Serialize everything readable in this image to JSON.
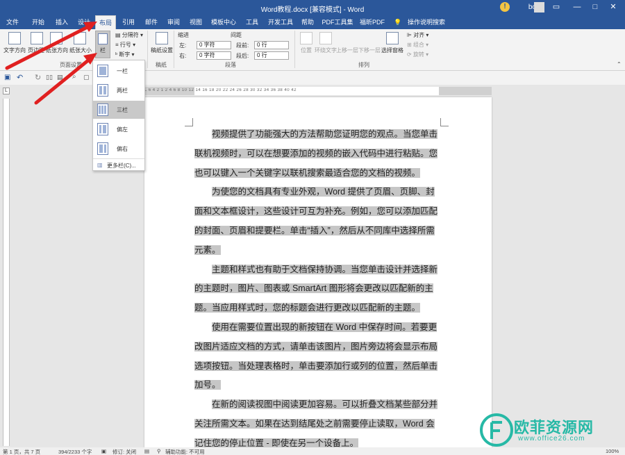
{
  "window": {
    "title": "Word教程.docx [兼容模式] - Word",
    "user": "bo",
    "minimize": "—",
    "restore": "□",
    "close": "✕",
    "warning": "!"
  },
  "tabs": [
    "文件",
    "开始",
    "插入",
    "设计",
    "布局",
    "引用",
    "邮件",
    "审阅",
    "视图",
    "模板中心",
    "工具",
    "开发工具",
    "帮助",
    "PDF工具集",
    "福昕PDF",
    "操作说明搜索"
  ],
  "ribbon": {
    "text_direction": "文字方向",
    "margins": "页边距",
    "orientation": "纸张方向",
    "size": "纸张大小",
    "columns": "栏",
    "breaks": "分隔符",
    "line_numbers": "行号",
    "hyphenation": "断字",
    "group_page_setup": "页面设置",
    "draft_paper": "稿纸设置",
    "group_draft": "稿纸",
    "indent": "缩进",
    "indent_left_label": "左:",
    "indent_left_value": "0 字符",
    "indent_right_label": "右:",
    "indent_right_value": "0 字符",
    "spacing": "间距",
    "spacing_before_label": "段前:",
    "spacing_before_value": "0 行",
    "spacing_after_label": "段后:",
    "spacing_after_value": "0 行",
    "group_paragraph": "段落",
    "position": "位置",
    "wrap_text": "环绕文字",
    "bring_forward": "上移一层",
    "send_backward": "下移一层",
    "selection_pane": "选择窗格",
    "align": "对齐",
    "group": "组合",
    "rotate": "旋转",
    "group_arrange": "排列"
  },
  "columns_menu": {
    "items": [
      "一栏",
      "两栏",
      "三栏",
      "偏左",
      "偏右"
    ],
    "selected_index": 2,
    "more": "更多栏(C)..."
  },
  "ruler": {
    "marks": "L 6 4 2 1 2 4 6 8 10 12 14 16 18 20 22 24 26 28 30 32 34 36 38 40 42"
  },
  "document": {
    "paragraphs": [
      "视频提供了功能强大的方法帮助您证明您的观点。当您单击联机视频时，可以在想要添加的视频的嵌入代码中进行粘贴。您也可以键入一个关键字以联机搜索最适合您的文档的视频。",
      "为使您的文档具有专业外观，Word 提供了页眉、页脚、封面和文本框设计，这些设计可互为补充。例如，您可以添加匹配的封面、页眉和提要栏。单击“插入”，然后从不同库中选择所需元素。",
      "主题和样式也有助于文档保持协调。当您单击设计并选择新的主题时，图片、图表或 SmartArt 图形将会更改以匹配新的主题。当应用样式时，您的标题会进行更改以匹配新的主题。",
      "使用在需要位置出现的新按钮在 Word 中保存时间。若要更改图片适应文档的方式，请单击该图片，图片旁边将会显示布局选项按钮。当处理表格时，单击要添加行或列的位置，然后单击加号。",
      "在新的阅读视图中阅读更加容易。可以折叠文档某些部分并关注所需文本。如果在达到结尾处之前需要停止读取，Word 会记住您的停止位置 - 即使在另一个设备上。"
    ]
  },
  "status": {
    "page": "第 1 页，共 7 页",
    "words": "394/2233 个字",
    "track": "修订: 关闭",
    "accessibility": "辅助功能: 不可用",
    "zoom": "100%"
  },
  "watermark": {
    "name": "欧菲资源网",
    "url": "www.office26.com"
  },
  "colors": {
    "accent": "#2b579a",
    "highlight": "#c6c6c6",
    "arrow": "#e02020"
  }
}
